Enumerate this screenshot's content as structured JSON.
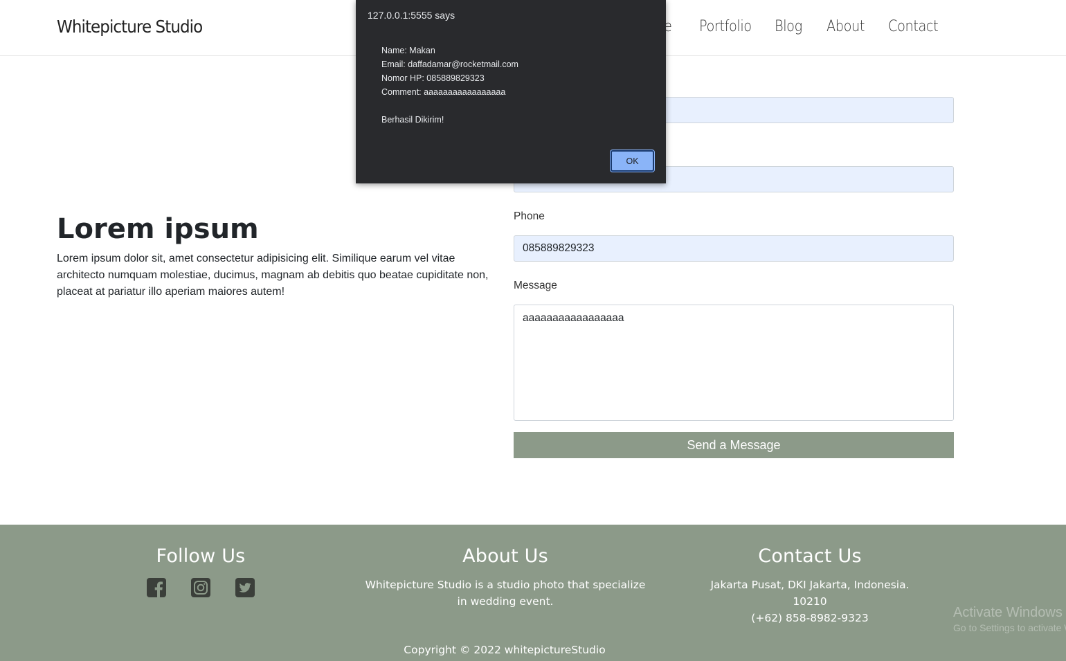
{
  "navbar": {
    "brand": "Whitepicture Studio",
    "links": [
      "Home",
      "Portfolio",
      "Blog",
      "About",
      "Contact"
    ],
    "partial_link": "e"
  },
  "hero": {
    "title": "Lorem ipsum",
    "text": "Lorem ipsum dolor sit, amet consectetur adipisicing elit. Similique earum vel vitae architecto numquam molestiae, ducimus, magnam ab debitis quo beatae cupiditate non, placeat at pariatur illo aperiam maiores autem!"
  },
  "form": {
    "name_value": "Makan",
    "email_value": "daffadamar@rocketmail.com",
    "phone_label": "Phone",
    "phone_value": "085889829323",
    "message_label": "Message",
    "message_value": "aaaaaaaaaaaaaaaaa",
    "submit_label": "Send a Message"
  },
  "footer": {
    "follow_title": "Follow Us",
    "about_title": "About Us",
    "about_text": "Whitepicture Studio is a studio photo that specialize in wedding event.",
    "contact_title": "Contact Us",
    "contact_address": "Jakarta Pusat, DKI Jakarta, Indonesia. 10210",
    "contact_phone": "(+62) 858-8982-9323",
    "copyright": "Copyright © 2022 whitepictureStudio",
    "social_icons": [
      "facebook-icon",
      "instagram-icon",
      "twitter-icon"
    ]
  },
  "watermark": {
    "line1": "Activate Windows",
    "line2": "Go to Settings to activate Windows."
  },
  "alert": {
    "title": "127.0.0.1:5555 says",
    "lines": [
      "Name: Makan",
      "Email: daffadamar@rocketmail.com",
      "Nomor HP: 085889829323",
      "Comment: aaaaaaaaaaaaaaaaa",
      "",
      "Berhasil Dikirim!"
    ],
    "ok_label": "OK"
  },
  "colors": {
    "accent": "#8c9a89",
    "input_autofill": "#e8f0fe",
    "dialog_bg": "#292a2d",
    "dialog_button": "#8ab4f8"
  }
}
